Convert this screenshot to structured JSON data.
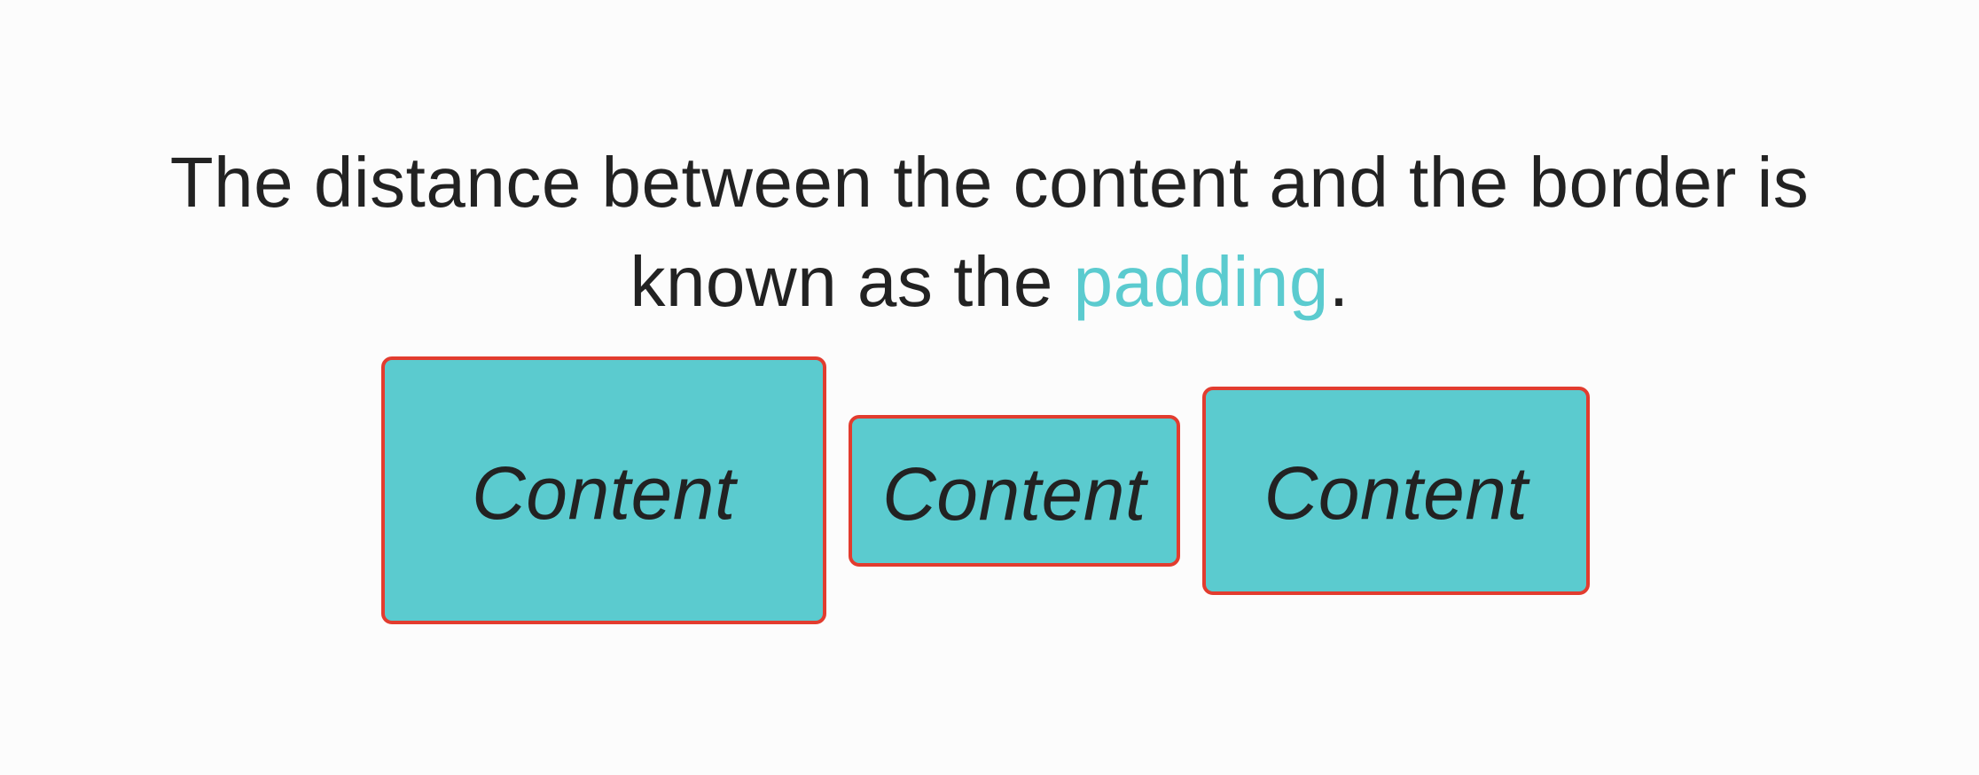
{
  "caption": {
    "line1": "The distance between the content and the border is",
    "line2_prefix": "known as the ",
    "highlight": "padding",
    "line2_suffix": "."
  },
  "boxes": [
    {
      "label": "Content"
    },
    {
      "label": "Content"
    },
    {
      "label": "Content"
    }
  ],
  "colors": {
    "fill": "#5bcbcf",
    "border": "#e23c2f",
    "text": "#222222",
    "highlight": "#5bcbcf",
    "background": "#fcfcfc"
  }
}
